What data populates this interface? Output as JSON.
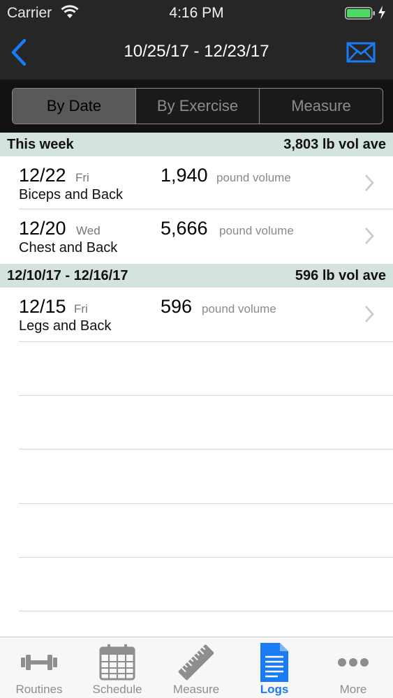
{
  "status_bar": {
    "carrier": "Carrier",
    "time": "4:16 PM"
  },
  "nav": {
    "title": "10/25/17 - 12/23/17",
    "back_icon": "chevron-left-icon",
    "action_icon": "envelope-icon"
  },
  "segments": [
    "By Date",
    "By Exercise",
    "Measure"
  ],
  "sections": [
    {
      "title": "This week",
      "summary": "3,803 lb vol ave",
      "rows": [
        {
          "date": "12/22",
          "day": "Fri",
          "workout": "Biceps and Back",
          "volume": "1,940",
          "unit": "pound volume"
        },
        {
          "date": "12/20",
          "day": "Wed",
          "workout": "Chest and Back",
          "volume": "5,666",
          "unit": "pound volume"
        }
      ]
    },
    {
      "title": "12/10/17 - 12/16/17",
      "summary": "596 lb vol ave",
      "rows": [
        {
          "date": "12/15",
          "day": "Fri",
          "workout": "Legs and Back",
          "volume": "596",
          "unit": "pound volume"
        }
      ]
    }
  ],
  "tabs": [
    {
      "label": "Routines",
      "icon": "dumbbell-icon"
    },
    {
      "label": "Schedule",
      "icon": "calendar-icon"
    },
    {
      "label": "Measure",
      "icon": "ruler-icon"
    },
    {
      "label": "Logs",
      "icon": "document-icon"
    },
    {
      "label": "More",
      "icon": "more-icon"
    }
  ],
  "colors": {
    "accent": "#1a7cf4",
    "section_bg": "#d5e3df",
    "bar_bg": "#262626"
  }
}
